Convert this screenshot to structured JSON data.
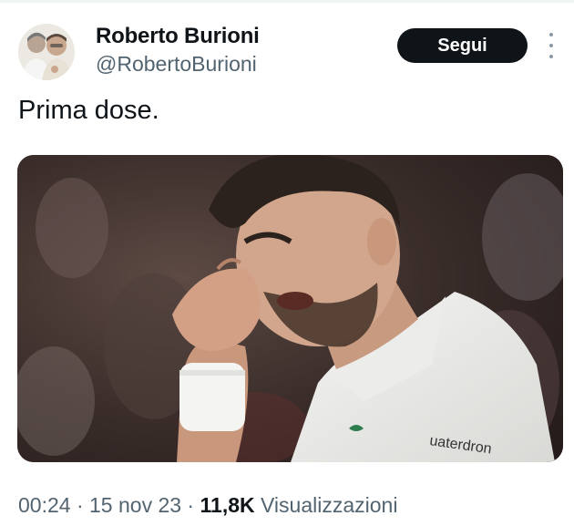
{
  "tweet": {
    "author": {
      "name": "Roberto Burioni",
      "handle": "@RobertoBurioni",
      "avatar": "profile-photo-two-men"
    },
    "follow_label": "Segui",
    "more_icon": "more-vertical-icon",
    "text": "Prima dose.",
    "media": {
      "kind": "photo",
      "subject": "tennis player wiping eye with wristband",
      "shirt_lettering": "uaterdron"
    },
    "meta": {
      "time": "00:24",
      "sep1": " · ",
      "date": "15 nov 23",
      "sep2": " · ",
      "views_count": "11,8K",
      "views_label": " Visualizzazioni"
    }
  },
  "colors": {
    "text_primary": "#0f1419",
    "text_secondary": "#536471",
    "button_bg": "#0f1419",
    "button_text": "#ffffff"
  }
}
